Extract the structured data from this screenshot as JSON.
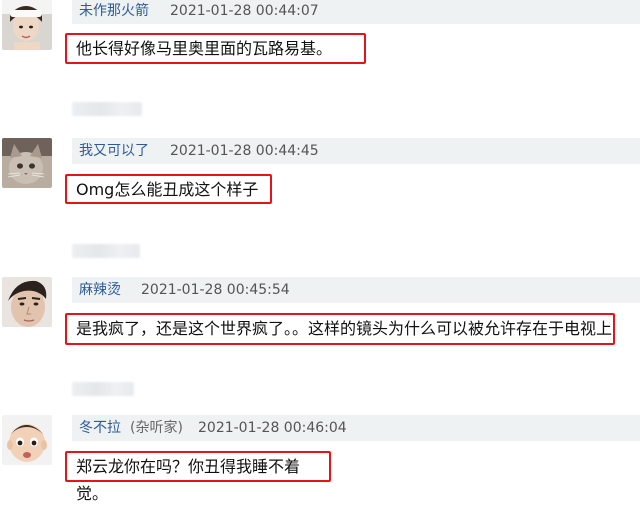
{
  "comments": [
    {
      "username": "未作那火箭",
      "tag": "",
      "timestamp": "2021-01-28 00:44:07",
      "text": "他长得好像马里奥里面的瓦路易基。"
    },
    {
      "username": "我又可以了",
      "tag": "",
      "timestamp": "2021-01-28 00:44:45",
      "text": "Omg怎么能丑成这个样子"
    },
    {
      "username": "麻辣烫",
      "tag": "",
      "timestamp": "2021-01-28 00:45:54",
      "text": "是我疯了，还是这个世界疯了。。这样的镜头为什么可以被允许存在于电视上"
    },
    {
      "username": "冬不拉",
      "tag": "(杂听家)",
      "timestamp": "2021-01-28 00:46:04",
      "text": "郑云龙你在吗？你丑得我睡不着觉。"
    }
  ],
  "colors": {
    "username": "#2f5b9a",
    "highlight_border": "#e5141b",
    "meta_bg": "#eef2f2"
  },
  "icons": [
    "avatar-girl-icon",
    "avatar-cat-icon",
    "avatar-man-icon",
    "avatar-baby-icon"
  ]
}
